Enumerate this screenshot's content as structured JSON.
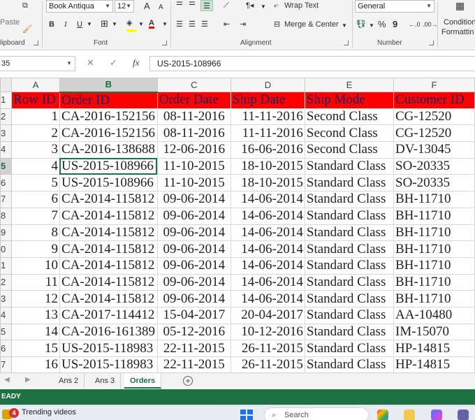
{
  "ribbon": {
    "font_name": "Book Antiqua",
    "font_size": "12",
    "paste_label": "Paste",
    "clipboard_label": "lipboard",
    "font_group_label": "Font",
    "alignment_group_label": "Alignment",
    "number_group_label": "Number",
    "wrap_text_label": "Wrap Text",
    "merge_center_label": "Merge & Center",
    "number_format": "General",
    "conditional_label": "Condition",
    "formatting_label": "Formattin",
    "bold": "B",
    "italic": "I",
    "underline": "U",
    "grow_font": "A",
    "shrink_font": "A",
    "percent": "%",
    "comma": "9",
    "font_color_letter": "A",
    "colors": {
      "fill": "#ffff00",
      "font": "#ff0000"
    }
  },
  "formula_bar": {
    "name_box": "35",
    "fx": "fx",
    "formula": "US-2015-108966"
  },
  "grid": {
    "columns": [
      "A",
      "B",
      "C",
      "D",
      "E",
      "F"
    ],
    "active_column": "B",
    "row_numbers": [
      "1",
      "2",
      "3",
      "4",
      "5",
      "6",
      "7",
      "8",
      "9",
      "0",
      "1",
      "2",
      "3",
      "4",
      "5",
      "6",
      "7"
    ],
    "header_row": [
      "Row ID",
      "Order ID",
      "Order Date",
      "Ship Date",
      "Ship Mode",
      "Customer ID"
    ],
    "rows": [
      [
        "1",
        "CA-2016-152156",
        "08-11-2016",
        "11-11-2016",
        "Second Class",
        "CG-12520"
      ],
      [
        "2",
        "CA-2016-152156",
        "08-11-2016",
        "11-11-2016",
        "Second Class",
        "CG-12520"
      ],
      [
        "3",
        "CA-2016-138688",
        "12-06-2016",
        "16-06-2016",
        "Second Class",
        "DV-13045"
      ],
      [
        "4",
        "US-2015-108966",
        "11-10-2015",
        "18-10-2015",
        "Standard Class",
        "SO-20335"
      ],
      [
        "5",
        "US-2015-108966",
        "11-10-2015",
        "18-10-2015",
        "Standard Class",
        "SO-20335"
      ],
      [
        "6",
        "CA-2014-115812",
        "09-06-2014",
        "14-06-2014",
        "Standard Class",
        "BH-11710"
      ],
      [
        "7",
        "CA-2014-115812",
        "09-06-2014",
        "14-06-2014",
        "Standard Class",
        "BH-11710"
      ],
      [
        "8",
        "CA-2014-115812",
        "09-06-2014",
        "14-06-2014",
        "Standard Class",
        "BH-11710"
      ],
      [
        "9",
        "CA-2014-115812",
        "09-06-2014",
        "14-06-2014",
        "Standard Class",
        "BH-11710"
      ],
      [
        "10",
        "CA-2014-115812",
        "09-06-2014",
        "14-06-2014",
        "Standard Class",
        "BH-11710"
      ],
      [
        "11",
        "CA-2014-115812",
        "09-06-2014",
        "14-06-2014",
        "Standard Class",
        "BH-11710"
      ],
      [
        "12",
        "CA-2014-115812",
        "09-06-2014",
        "14-06-2014",
        "Standard Class",
        "BH-11710"
      ],
      [
        "13",
        "CA-2017-114412",
        "15-04-2017",
        "20-04-2017",
        "Standard Class",
        "AA-10480"
      ],
      [
        "14",
        "CA-2016-161389",
        "05-12-2016",
        "10-12-2016",
        "Standard Class",
        "IM-15070"
      ],
      [
        "15",
        "US-2015-118983",
        "22-11-2015",
        "26-11-2015",
        "Standard Class",
        "HP-14815"
      ],
      [
        "16",
        "US-2015-118983",
        "22-11-2015",
        "26-11-2015",
        "Standard Class",
        "HP-14815"
      ]
    ],
    "colors": {
      "header_fill": "#ff0000",
      "selection": "#1e7145"
    }
  },
  "sheets": {
    "tabs": [
      "Ans 2",
      "Ans 3",
      "Orders"
    ],
    "active": "Orders"
  },
  "status": {
    "text": "EADY"
  },
  "taskbar": {
    "notification_count": "4",
    "trending": "Trending videos",
    "search_placeholder": "Search"
  }
}
